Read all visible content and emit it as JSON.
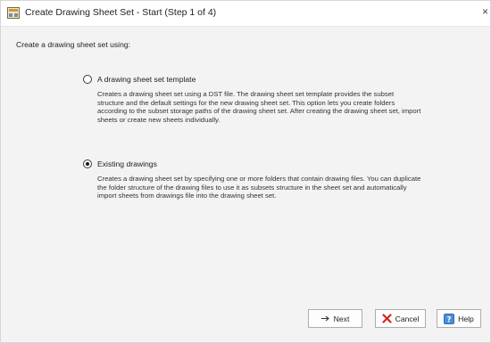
{
  "window": {
    "title": "Create Drawing Sheet Set - Start (Step 1 of 4)",
    "close_glyph": "×"
  },
  "prompt": "Create a drawing sheet set using:",
  "options": [
    {
      "label": "A drawing sheet set template",
      "selected": false,
      "description": "Creates a drawing sheet set using a DST file. The drawing sheet set template provides the subset structure and the default settings for the new drawing sheet set. This option lets you create folders according to the subset storage paths of the drawing sheet set. After creating the drawing sheet set, import sheets or create new sheets individually."
    },
    {
      "label": "Existing drawings",
      "selected": true,
      "description": "Creates a drawing sheet set by specifying one or more folders that contain drawing files. You can duplicate the folder structure of the drawing files to use it as subsets structure in the sheet set and automatically import sheets from drawings file into the drawing sheet set."
    }
  ],
  "buttons": {
    "next": {
      "label": "Next",
      "icon": "arrow-right-icon"
    },
    "cancel": {
      "label": "Cancel",
      "icon": "red-x-icon"
    },
    "help": {
      "label": "Help",
      "icon": "help-book-icon"
    }
  },
  "colors": {
    "cancel_x": "#d3281c",
    "help_icon": "#4a90d9",
    "dialog_bg": "#f3f3f3"
  }
}
